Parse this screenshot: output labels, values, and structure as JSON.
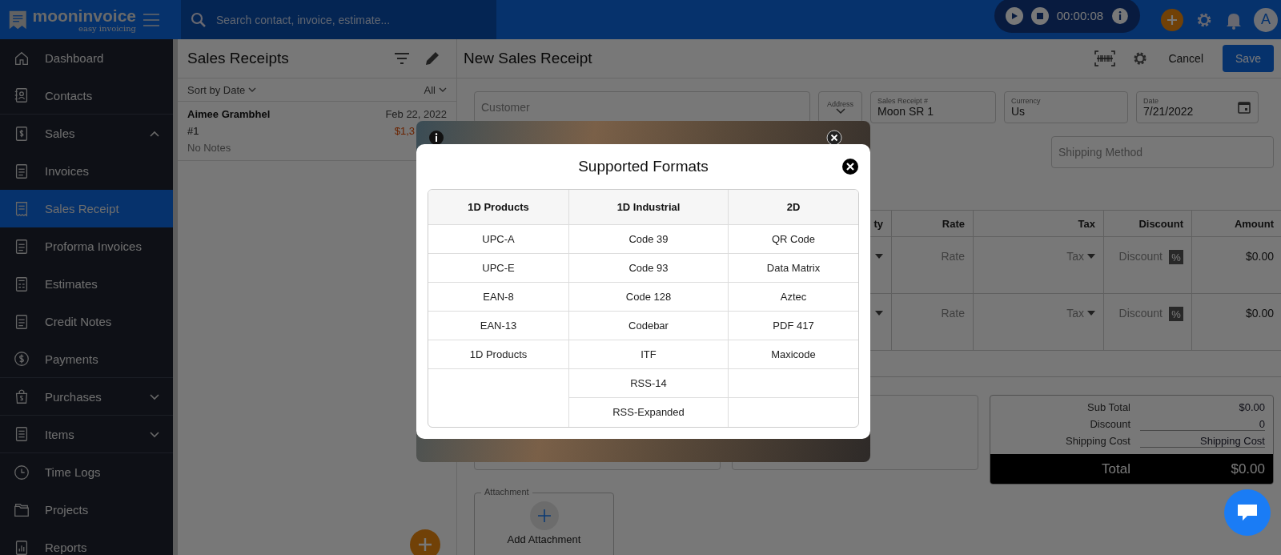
{
  "topbar": {
    "logo": {
      "name": "mooninvoice",
      "tagline": "easy invoicing"
    },
    "search": {
      "placeholder": "Search contact, invoice, estimate..."
    },
    "timer": "00:00:08",
    "avatar": "A"
  },
  "sidebar": {
    "items": [
      {
        "label": "Dashboard",
        "kind": "link",
        "selected": false
      },
      {
        "label": "Contacts",
        "kind": "link",
        "selected": false
      },
      {
        "label": "Sales",
        "kind": "group",
        "selected": false,
        "expanded": true
      },
      {
        "label": "Invoices",
        "kind": "link",
        "selected": false
      },
      {
        "label": "Sales Receipt",
        "kind": "link",
        "selected": true
      },
      {
        "label": "Proforma Invoices",
        "kind": "link",
        "selected": false
      },
      {
        "label": "Estimates",
        "kind": "link",
        "selected": false
      },
      {
        "label": "Credit Notes",
        "kind": "link",
        "selected": false
      },
      {
        "label": "Payments",
        "kind": "link",
        "selected": false
      },
      {
        "label": "Purchases",
        "kind": "group",
        "selected": false,
        "expanded": false
      },
      {
        "label": "Items",
        "kind": "group",
        "selected": false,
        "expanded": false
      },
      {
        "label": "Time Logs",
        "kind": "link",
        "selected": false
      },
      {
        "label": "Projects",
        "kind": "link",
        "selected": false
      },
      {
        "label": "Reports",
        "kind": "link",
        "selected": false
      }
    ]
  },
  "receipt_list": {
    "title": "Sales Receipts",
    "sort": "Sort by Date",
    "filter": "All",
    "receipts": [
      {
        "name": "Aimee Grambhel",
        "date": "Feb 22, 2022",
        "number": "#1",
        "amount": "$1,3",
        "notes": "No Notes"
      }
    ]
  },
  "editor": {
    "title": "New Sales Receipt",
    "cancel": "Cancel",
    "save": "Save",
    "fields": {
      "customer": {
        "placeholder": "Customer"
      },
      "address": {
        "label": "Address"
      },
      "receipt_number": {
        "label": "Sales Receipt #",
        "value": "Moon SR 1"
      },
      "currency": {
        "label": "Currency",
        "value": "Us"
      },
      "date": {
        "label": "Date",
        "value": "7/21/2022"
      },
      "shipping_method": {
        "placeholder": "Shipping Method"
      }
    },
    "items_table": {
      "columns": [
        "ty",
        "Rate",
        "Tax",
        "Discount",
        "Amount"
      ],
      "rows": [
        {
          "rate": {
            "placeholder": "Rate"
          },
          "tax": "Tax",
          "discount": {
            "placeholder": "Discount",
            "unit": "%"
          },
          "amount": "$0.00"
        },
        {
          "rate": {
            "placeholder": "Rate"
          },
          "tax": "Tax",
          "discount": {
            "placeholder": "Discount",
            "unit": "%"
          },
          "amount": "$0.00"
        }
      ]
    },
    "totals": {
      "sub_total": {
        "label": "Sub Total",
        "value": "$0.00"
      },
      "discount": {
        "label": "Discount",
        "value": "0"
      },
      "shipping_cost": {
        "label": "Shipping Cost",
        "placeholder": "Shipping Cost"
      },
      "total": {
        "label": "Total",
        "value": "$0.00"
      }
    },
    "attachment": {
      "legend": "Attachment",
      "button": "Add Attachment"
    }
  },
  "modal": {
    "title": "Supported Formats",
    "columns": [
      {
        "heading": "1D Products",
        "items": [
          "UPC-A",
          "UPC-E",
          "EAN-8",
          "EAN-13",
          "1D Products"
        ]
      },
      {
        "heading": "1D Industrial",
        "items": [
          "Code 39",
          "Code 93",
          "Code 128",
          "Codebar",
          "ITF",
          "RSS-14",
          "RSS-Expanded"
        ]
      },
      {
        "heading": "2D",
        "items": [
          "QR Code",
          "Data Matrix",
          "Aztec",
          "PDF 417",
          "Maxicode"
        ]
      }
    ]
  }
}
